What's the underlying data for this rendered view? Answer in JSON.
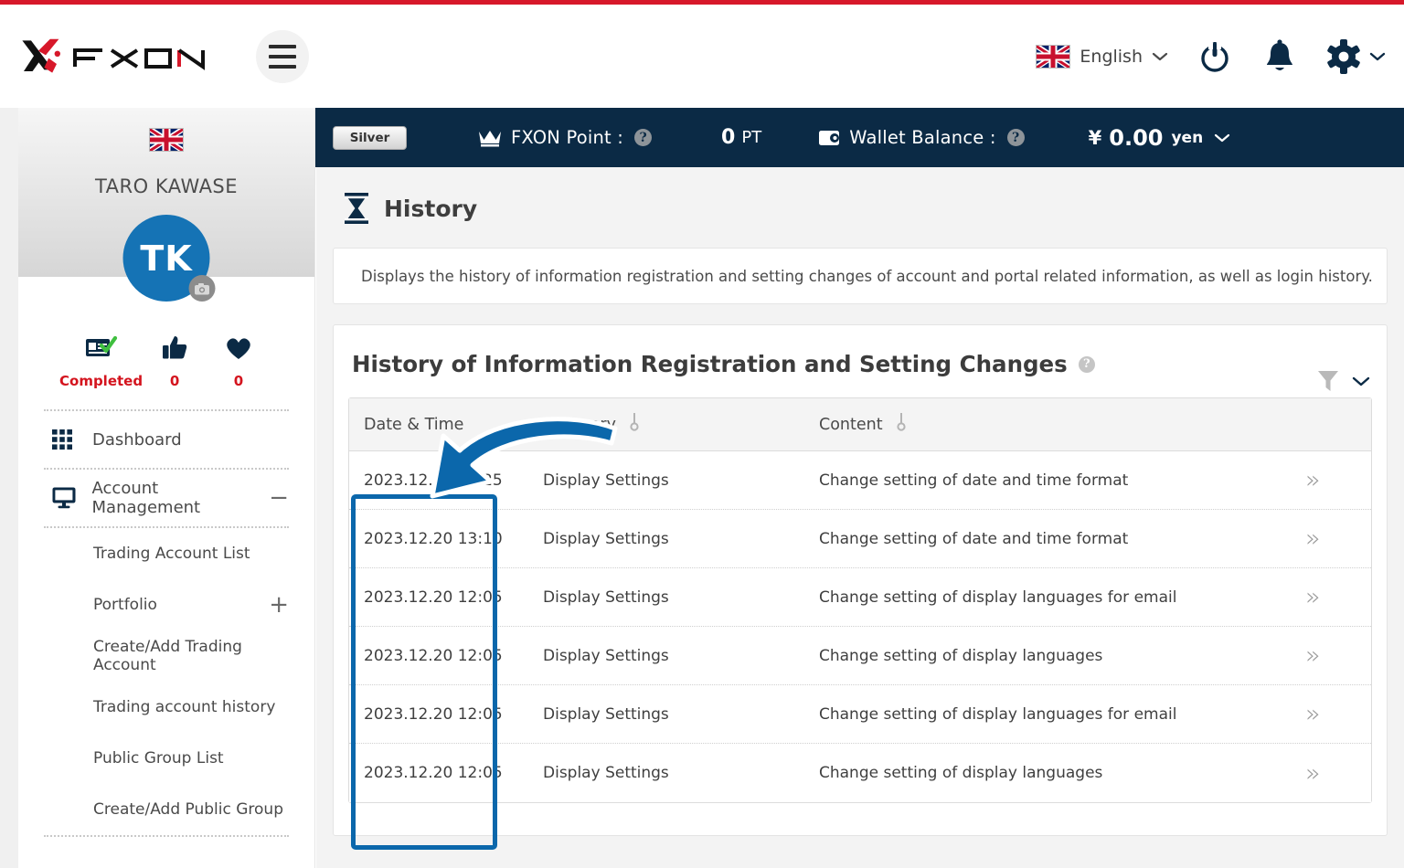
{
  "brand": {
    "name": "FXON"
  },
  "header": {
    "menu_icon": "hamburger-menu-icon",
    "language": {
      "label": "English",
      "flag": "uk-flag-icon",
      "chevron": "chevron-down-icon"
    },
    "power_icon": "power-icon",
    "bell_icon": "notification-bell-icon",
    "gear_icon": "gear-icon"
  },
  "statusbar": {
    "rank_badge": "Silver",
    "point_icon": "crown-icon",
    "point_label": "FXON Point :",
    "point_help": "?",
    "point_value": "0",
    "point_unit": "PT",
    "wallet_icon": "wallet-icon",
    "wallet_label": "Wallet Balance :",
    "wallet_help": "?",
    "currency_symbol": "¥",
    "wallet_value": "0.00",
    "wallet_unit": "yen",
    "wallet_chevron": "chevron-down-icon"
  },
  "sidebar": {
    "flag": "uk-flag-icon",
    "user_name": "TARO KAWASE",
    "avatar_initials": "TK",
    "camera_icon": "camera-icon",
    "stats": [
      {
        "icon": "id-card-verified-icon",
        "label": "Completed"
      },
      {
        "icon": "thumbs-up-icon",
        "label": "0"
      },
      {
        "icon": "heart-icon",
        "label": "0"
      }
    ],
    "items": [
      {
        "label": "Dashboard",
        "icon": "grid-icon",
        "action": ""
      },
      {
        "label": "Account Management",
        "icon": "monitor-icon",
        "action": "−"
      }
    ],
    "sub_items": [
      {
        "label": "Trading Account List",
        "action": ""
      },
      {
        "label": "Portfolio",
        "action": "+"
      },
      {
        "label": "Create/Add Trading Account",
        "action": ""
      },
      {
        "label": "Trading account history",
        "action": ""
      },
      {
        "label": "Public Group List",
        "action": ""
      },
      {
        "label": "Create/Add Public Group",
        "action": ""
      }
    ]
  },
  "main": {
    "page_icon": "hourglass-icon",
    "page_title": "History",
    "description": "Displays the history of information registration and setting changes of account and portal related information, as well as login history.",
    "panel_title": "History of Information Registration and Setting Changes",
    "panel_help": "?",
    "filter_icon": "filter-funnel-icon",
    "filter_chevron": "chevron-down-icon",
    "table": {
      "columns": [
        {
          "key": "date",
          "label": "Date & Time",
          "sortable": false
        },
        {
          "key": "category",
          "label": "Category",
          "sortable": true
        },
        {
          "key": "content",
          "label": "Content",
          "sortable": true
        },
        {
          "key": "action",
          "label": "",
          "sortable": false
        }
      ],
      "rows": [
        {
          "date": "2023.12.20 13:25",
          "category": "Display Settings",
          "content": "Change setting of date and time format",
          "action": "»"
        },
        {
          "date": "2023.12.20 13:10",
          "category": "Display Settings",
          "content": "Change setting of date and time format",
          "action": "»"
        },
        {
          "date": "2023.12.20 12:05",
          "category": "Display Settings",
          "content": "Change setting of display languages for email",
          "action": "»"
        },
        {
          "date": "2023.12.20 12:05",
          "category": "Display Settings",
          "content": "Change setting of display languages",
          "action": "»"
        },
        {
          "date": "2023.12.20 12:05",
          "category": "Display Settings",
          "content": "Change setting of display languages for email",
          "action": "»"
        },
        {
          "date": "2023.12.20 12:05",
          "category": "Display Settings",
          "content": "Change setting of display languages",
          "action": "»"
        }
      ]
    }
  },
  "annotation": {
    "highlight_color": "#0b67ab",
    "arrow": "curved-arrow-pointing-to-date-time-column"
  },
  "colors": {
    "brand_red": "#d7182a",
    "navy": "#0b2a45",
    "accent_blue": "#0b67ab",
    "avatar_blue": "#1573b5",
    "stat_red": "#d4141e"
  }
}
